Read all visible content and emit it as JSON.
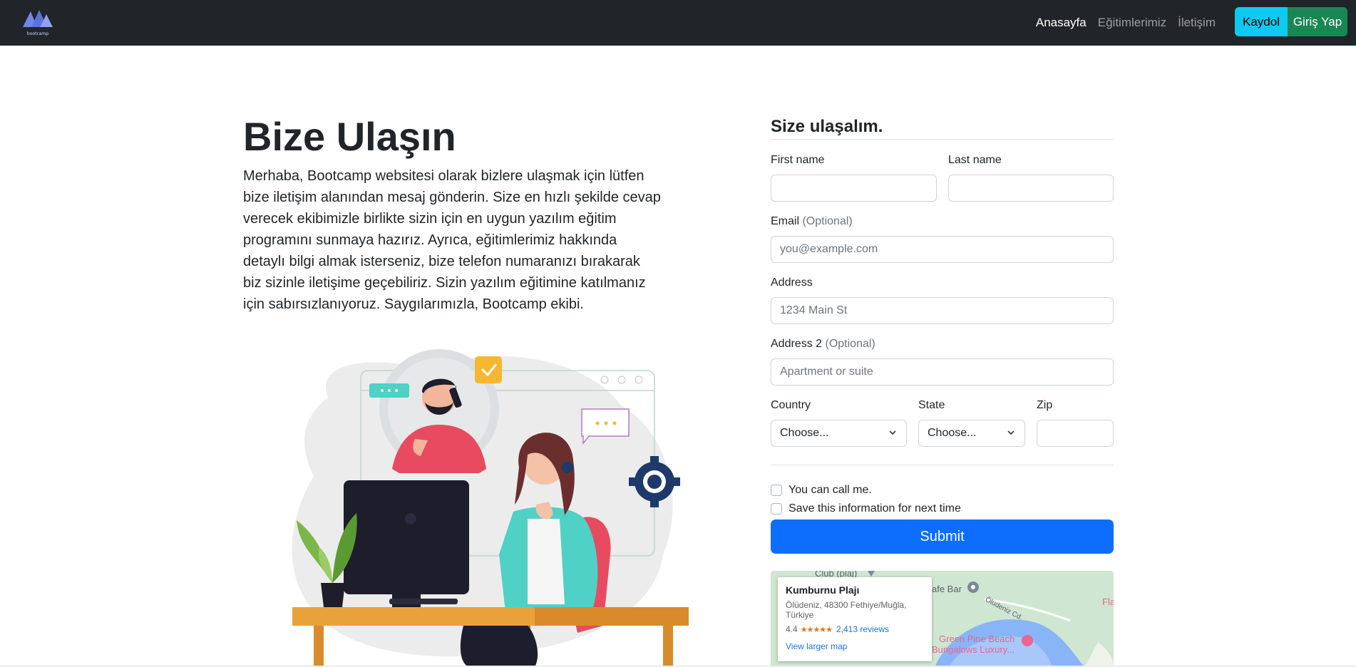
{
  "nav": {
    "logo_text": "bootcamp",
    "links": [
      {
        "label": "Anasayfa"
      },
      {
        "label": "Eğitimlerimiz"
      },
      {
        "label": "İletişim"
      }
    ],
    "register_label": "Kaydol",
    "login_label": "Giriş Yap"
  },
  "hero": {
    "title": "Bize Ulaşın",
    "intro": "Merhaba, Bootcamp websitesi olarak bizlere ulaşmak için lütfen bize iletişim alanından mesaj gönderin. Size en hızlı şekilde cevap verecek ekibimizle birlikte sizin için en uygun yazılım eğitim programını sunmaya hazırız. Ayrıca, eğitimlerimiz hakkında detaylı bilgi almak isterseniz, bize telefon numaranızı bırakarak biz sizinle iletişime geçebiliriz. Sizin yazılım eğitimine katılmanız için sabırsızlanıyoruz. Saygılarımızla, Bootcamp ekibi."
  },
  "form": {
    "heading": "Size ulaşalım.",
    "first_name": {
      "label": "First name",
      "value": ""
    },
    "last_name": {
      "label": "Last name",
      "value": ""
    },
    "email": {
      "label": "Email",
      "optional": "(Optional)",
      "placeholder": "you@example.com"
    },
    "address": {
      "label": "Address",
      "placeholder": "1234 Main St"
    },
    "address2": {
      "label": "Address 2",
      "optional": "(Optional)",
      "placeholder": "Apartment or suite"
    },
    "country": {
      "label": "Country",
      "selected": "Choose..."
    },
    "state": {
      "label": "State",
      "selected": "Choose..."
    },
    "zip": {
      "label": "Zip",
      "value": ""
    },
    "checks": [
      {
        "label": "You can call me.",
        "checked": false
      },
      {
        "label": "Save this information for next time",
        "checked": false
      }
    ],
    "submit_label": "Submit"
  },
  "map": {
    "place_name": "Kumburnu Plajı",
    "address_line1": "Ölüdeniz, 48300 Fethiye/Muğla,",
    "address_line2": "Türkiye",
    "rating": "4.4",
    "stars": "★★★★★",
    "reviews": "2,413 reviews",
    "larger_map": "View larger map",
    "labels": {
      "club": "Club (plaj)",
      "cafe": "afe Bar",
      "road": "Ölüdeniz Cd.",
      "hotel_1": "Green Pine Beach",
      "hotel_2": "Bungalows Luxury...",
      "edge": "Fla"
    }
  },
  "colors": {
    "navbar": "#212529",
    "info": "#0dcaf0",
    "success": "#198754",
    "primary": "#0d6efd"
  }
}
